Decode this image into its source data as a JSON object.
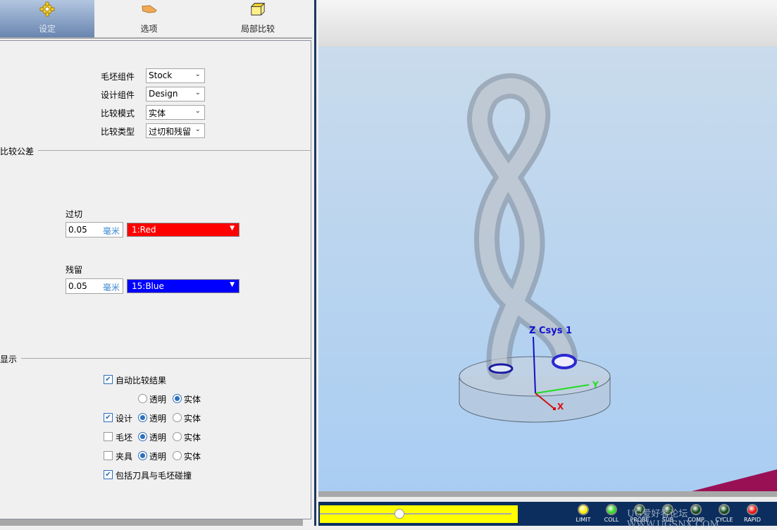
{
  "tabs": [
    {
      "label": "设定",
      "icon": "gear-icon",
      "active": true
    },
    {
      "label": "选项",
      "icon": "pointing-hand-icon"
    },
    {
      "label": "局部比较",
      "icon": "cube-icon"
    }
  ],
  "settings": {
    "stock_label": "毛坯组件",
    "stock_value": "Stock",
    "design_label": "设计组件",
    "design_value": "Design",
    "mode_label": "比较模式",
    "mode_value": "实体",
    "type_label": "比较类型",
    "type_value": "过切和残留"
  },
  "tolerance": {
    "title": "比较公差",
    "gouge_label": "过切",
    "gouge_value": "0.05",
    "gouge_unit": "毫米",
    "gouge_color": "1:Red",
    "gouge_hex": "#ff0000",
    "excess_label": "残留",
    "excess_value": "0.05",
    "excess_unit": "毫米",
    "excess_color": "15:Blue",
    "excess_hex": "#0000ff"
  },
  "display": {
    "title": "显示",
    "auto_compare": "自动比较结果",
    "auto_compare_checked": true,
    "transparent": "透明",
    "solid": "实体",
    "design": "设计",
    "design_checked": true,
    "stock": "毛坯",
    "stock_checked": false,
    "fixture": "夹具",
    "fixture_checked": false,
    "include_collision": "包括刀具与毛坯碰撞",
    "include_collision_checked": true
  },
  "viewport": {
    "csys_label": "Z Csys 1",
    "x_label": "X",
    "y_label": "Y"
  },
  "status": {
    "slider_position": 0.4,
    "leds": [
      {
        "label": "LIMIT",
        "color": "#ffee00"
      },
      {
        "label": "COLL",
        "color": "#33dd22"
      },
      {
        "label": "PROBE",
        "color": "#0c4a1a"
      },
      {
        "label": "SUB",
        "color": "#0c4a1a"
      },
      {
        "label": "COMP",
        "color": "#0c4a1a"
      },
      {
        "label": "CYCLE",
        "color": "#0c4a1a"
      },
      {
        "label": "RAPID",
        "color": "#ee1111"
      }
    ],
    "watermark": "UG爱好者论坛 WWW.UGSNX.COM"
  }
}
